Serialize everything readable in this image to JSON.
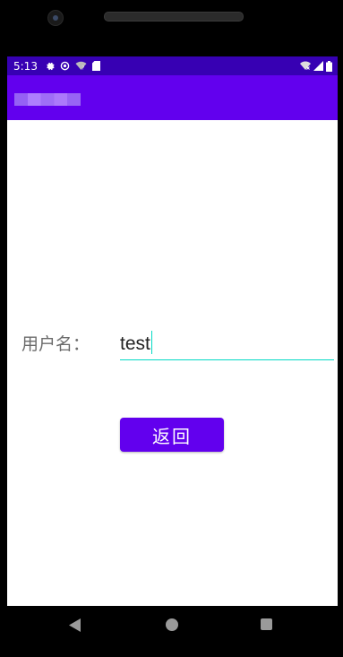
{
  "status_bar": {
    "time": "5:13",
    "left_icons": [
      "gear-icon",
      "no-disturb-icon",
      "wifi-question-icon",
      "sd-card-icon"
    ],
    "right_icons": [
      "wifi-x-icon",
      "signal-icon",
      "battery-icon"
    ],
    "bg_color": "#3700B3"
  },
  "app_bar": {
    "title": "",
    "bg_color": "#6200EE"
  },
  "form": {
    "username_label": "用户名：",
    "username_value": "test"
  },
  "actions": {
    "back_label": "返回"
  },
  "nav_bar": {
    "icons": [
      "back-triangle-icon",
      "home-circle-icon",
      "recents-square-icon"
    ]
  },
  "colors": {
    "accent": "#03DAC5",
    "primary": "#6200EE",
    "primary_dark": "#3700B3"
  }
}
